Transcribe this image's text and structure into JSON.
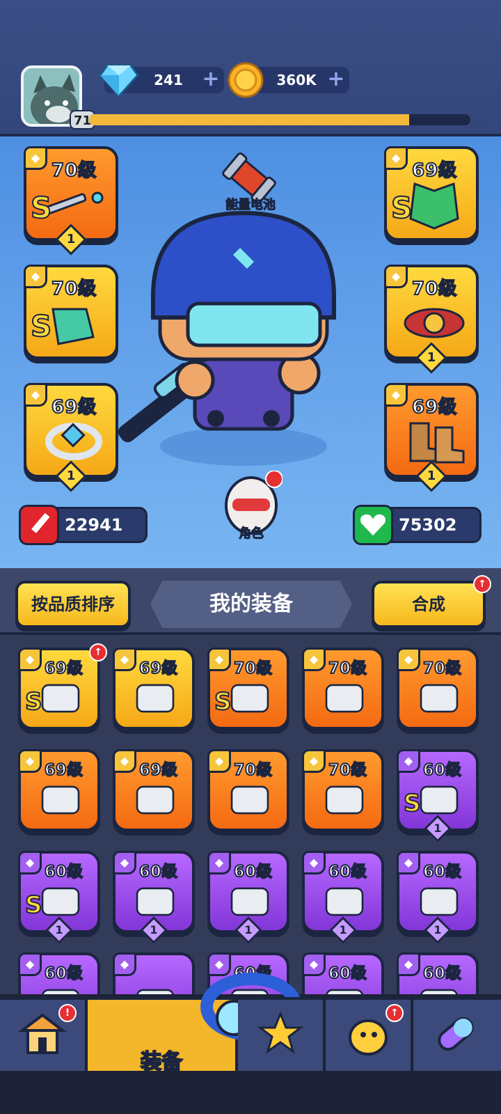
{
  "header": {
    "player_level": "71",
    "xp_fraction": 0.84,
    "gems": "241",
    "coins": "360K"
  },
  "stage": {
    "battery_label": "能量电池",
    "character_label": "角色",
    "attack": "22941",
    "health": "75302",
    "slots": [
      {
        "level": "70级",
        "s": "S",
        "tier": "1",
        "item": "dagger-icon",
        "color": "orange"
      },
      {
        "level": "69级",
        "s": "S",
        "tier": "",
        "item": "armor-icon",
        "color": "gold"
      },
      {
        "level": "70级",
        "s": "S",
        "tier": "",
        "item": "gauntlet-icon",
        "color": "gold"
      },
      {
        "level": "70级",
        "s": "",
        "tier": "1",
        "item": "belt-icon",
        "color": "gold"
      },
      {
        "level": "69级",
        "s": "",
        "tier": "1",
        "item": "ring-icon",
        "color": "gold"
      },
      {
        "level": "69级",
        "s": "",
        "tier": "1",
        "item": "boots-icon",
        "color": "orange"
      }
    ]
  },
  "panel": {
    "sort_label": "按品质排序",
    "title": "我的装备",
    "craft_label": "合成",
    "items": [
      {
        "level": "69级",
        "s": "S",
        "tier": "",
        "color": "gold"
      },
      {
        "level": "69级",
        "s": "",
        "tier": "",
        "color": "gold"
      },
      {
        "level": "70级",
        "s": "S",
        "tier": "",
        "color": "orange"
      },
      {
        "level": "70级",
        "s": "",
        "tier": "",
        "color": "orange"
      },
      {
        "level": "70级",
        "s": "",
        "tier": "",
        "color": "orange"
      },
      {
        "level": "69级",
        "s": "",
        "tier": "",
        "color": "orange"
      },
      {
        "level": "69级",
        "s": "",
        "tier": "",
        "color": "orange"
      },
      {
        "level": "70级",
        "s": "",
        "tier": "",
        "color": "orange"
      },
      {
        "level": "70级",
        "s": "",
        "tier": "",
        "color": "orange"
      },
      {
        "level": "60级",
        "s": "S",
        "tier": "1",
        "color": "purple"
      },
      {
        "level": "60级",
        "s": "S",
        "tier": "1",
        "color": "purple"
      },
      {
        "level": "60级",
        "s": "",
        "tier": "1",
        "color": "purple"
      },
      {
        "level": "60级",
        "s": "",
        "tier": "1",
        "color": "purple"
      },
      {
        "level": "60级",
        "s": "",
        "tier": "1",
        "color": "purple"
      },
      {
        "level": "60级",
        "s": "",
        "tier": "1",
        "color": "purple"
      },
      {
        "level": "60级",
        "s": "",
        "tier": "",
        "color": "purple"
      },
      {
        "level": "",
        "s": "",
        "tier": "",
        "color": "purple"
      },
      {
        "level": "60级",
        "s": "",
        "tier": "",
        "color": "purple"
      },
      {
        "level": "60级",
        "s": "",
        "tier": "",
        "color": "purple"
      },
      {
        "level": "60级",
        "s": "",
        "tier": "",
        "color": "purple"
      }
    ]
  },
  "nav": {
    "equip_label": "装备"
  }
}
